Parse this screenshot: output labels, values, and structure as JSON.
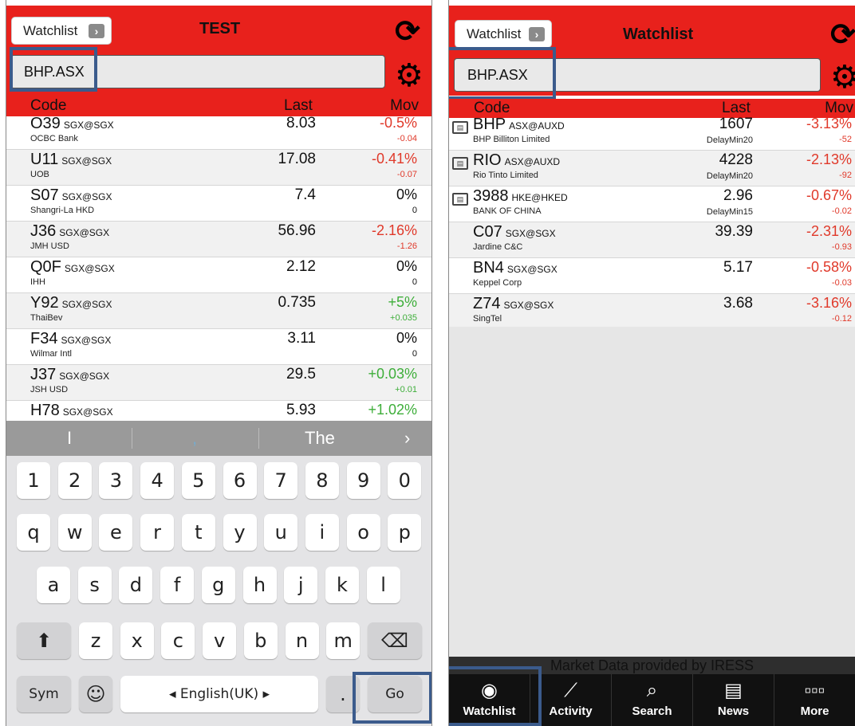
{
  "left": {
    "watchlist_label": "Watchlist",
    "title": "TEST",
    "search_value": "BHP.ASX",
    "columns": {
      "code": "Code",
      "last": "Last",
      "mov": "Mov"
    },
    "rows": [
      {
        "code": "O39",
        "exch": "SGX@SGX",
        "name": "OCBC Bank",
        "last": "8.03",
        "mov": "-0.5%",
        "mov2": "-0.04",
        "dir": "neg"
      },
      {
        "code": "U11",
        "exch": "SGX@SGX",
        "name": "UOB",
        "last": "17.08",
        "mov": "-0.41%",
        "mov2": "-0.07",
        "dir": "neg"
      },
      {
        "code": "S07",
        "exch": "SGX@SGX",
        "name": "Shangri-La HKD",
        "last": "7.4",
        "mov": "0%",
        "mov2": "0",
        "dir": "zero"
      },
      {
        "code": "J36",
        "exch": "SGX@SGX",
        "name": "JMH USD",
        "last": "56.96",
        "mov": "-2.16%",
        "mov2": "-1.26",
        "dir": "neg"
      },
      {
        "code": "Q0F",
        "exch": "SGX@SGX",
        "name": "IHH",
        "last": "2.12",
        "mov": "0%",
        "mov2": "0",
        "dir": "zero"
      },
      {
        "code": "Y92",
        "exch": "SGX@SGX",
        "name": "ThaiBev",
        "last": "0.735",
        "mov": "+5%",
        "mov2": "+0.035",
        "dir": "pos"
      },
      {
        "code": "F34",
        "exch": "SGX@SGX",
        "name": "Wilmar Intl",
        "last": "3.11",
        "mov": "0%",
        "mov2": "0",
        "dir": "zero"
      },
      {
        "code": "J37",
        "exch": "SGX@SGX",
        "name": "JSH USD",
        "last": "29.5",
        "mov": "+0.03%",
        "mov2": "+0.01",
        "dir": "pos"
      },
      {
        "code": "H78",
        "exch": "SGX@SGX",
        "name": "",
        "last": "5.93",
        "mov": "+1.02%",
        "mov2": "",
        "dir": "pos"
      }
    ],
    "keyboard": {
      "suggestions": [
        "I",
        ",",
        "The"
      ],
      "numbers": [
        "1",
        "2",
        "3",
        "4",
        "5",
        "6",
        "7",
        "8",
        "9",
        "0"
      ],
      "row1": [
        "q",
        "w",
        "e",
        "r",
        "t",
        "y",
        "u",
        "i",
        "o",
        "p"
      ],
      "row2": [
        "a",
        "s",
        "d",
        "f",
        "g",
        "h",
        "j",
        "k",
        "l"
      ],
      "row3": [
        "z",
        "x",
        "c",
        "v",
        "b",
        "n",
        "m"
      ],
      "sym": "Sym",
      "space": "◂ English(UK) ▸",
      "period": ".",
      "go": "Go"
    }
  },
  "right": {
    "watchlist_label": "Watchlist",
    "title": "Watchlist",
    "search_value": "BHP.ASX",
    "columns": {
      "code": "Code",
      "last": "Last",
      "mov": "Mov"
    },
    "rows": [
      {
        "code": "BHP",
        "exch": "ASX@AUXD",
        "name": "BHP Billiton Limited",
        "last": "1607",
        "sub": "DelayMin20",
        "mov": "-3.13%",
        "mov2": "-52",
        "dir": "neg",
        "news": true
      },
      {
        "code": "RIO",
        "exch": "ASX@AUXD",
        "name": "Rio Tinto Limited",
        "last": "4228",
        "sub": "DelayMin20",
        "mov": "-2.13%",
        "mov2": "-92",
        "dir": "neg",
        "news": true
      },
      {
        "code": "3988",
        "exch": "HKE@HKED",
        "name": "BANK OF CHINA",
        "last": "2.96",
        "sub": "DelayMin15",
        "mov": "-0.67%",
        "mov2": "-0.02",
        "dir": "neg",
        "news": true
      },
      {
        "code": "C07",
        "exch": "SGX@SGX",
        "name": "Jardine C&C",
        "last": "39.39",
        "sub": "",
        "mov": "-2.31%",
        "mov2": "-0.93",
        "dir": "neg",
        "news": false
      },
      {
        "code": "BN4",
        "exch": "SGX@SGX",
        "name": "Keppel Corp",
        "last": "5.17",
        "sub": "",
        "mov": "-0.58%",
        "mov2": "-0.03",
        "dir": "neg",
        "news": false
      },
      {
        "code": "Z74",
        "exch": "SGX@SGX",
        "name": "SingTel",
        "last": "3.68",
        "sub": "",
        "mov": "-3.16%",
        "mov2": "-0.12",
        "dir": "neg",
        "news": false
      }
    ],
    "market_data": "Market Data provided by IRESS",
    "nav": [
      {
        "label": "Watchlist",
        "icon": "eye-icon"
      },
      {
        "label": "Activity",
        "icon": "chart-icon"
      },
      {
        "label": "Search",
        "icon": "search-icon"
      },
      {
        "label": "News",
        "icon": "newspaper-icon"
      },
      {
        "label": "More",
        "icon": "more-icon"
      }
    ]
  },
  "colors": {
    "header_red": "#e8211c",
    "negative": "#e0392a",
    "positive": "#3eae3a",
    "highlight": "#3b5b8c"
  }
}
